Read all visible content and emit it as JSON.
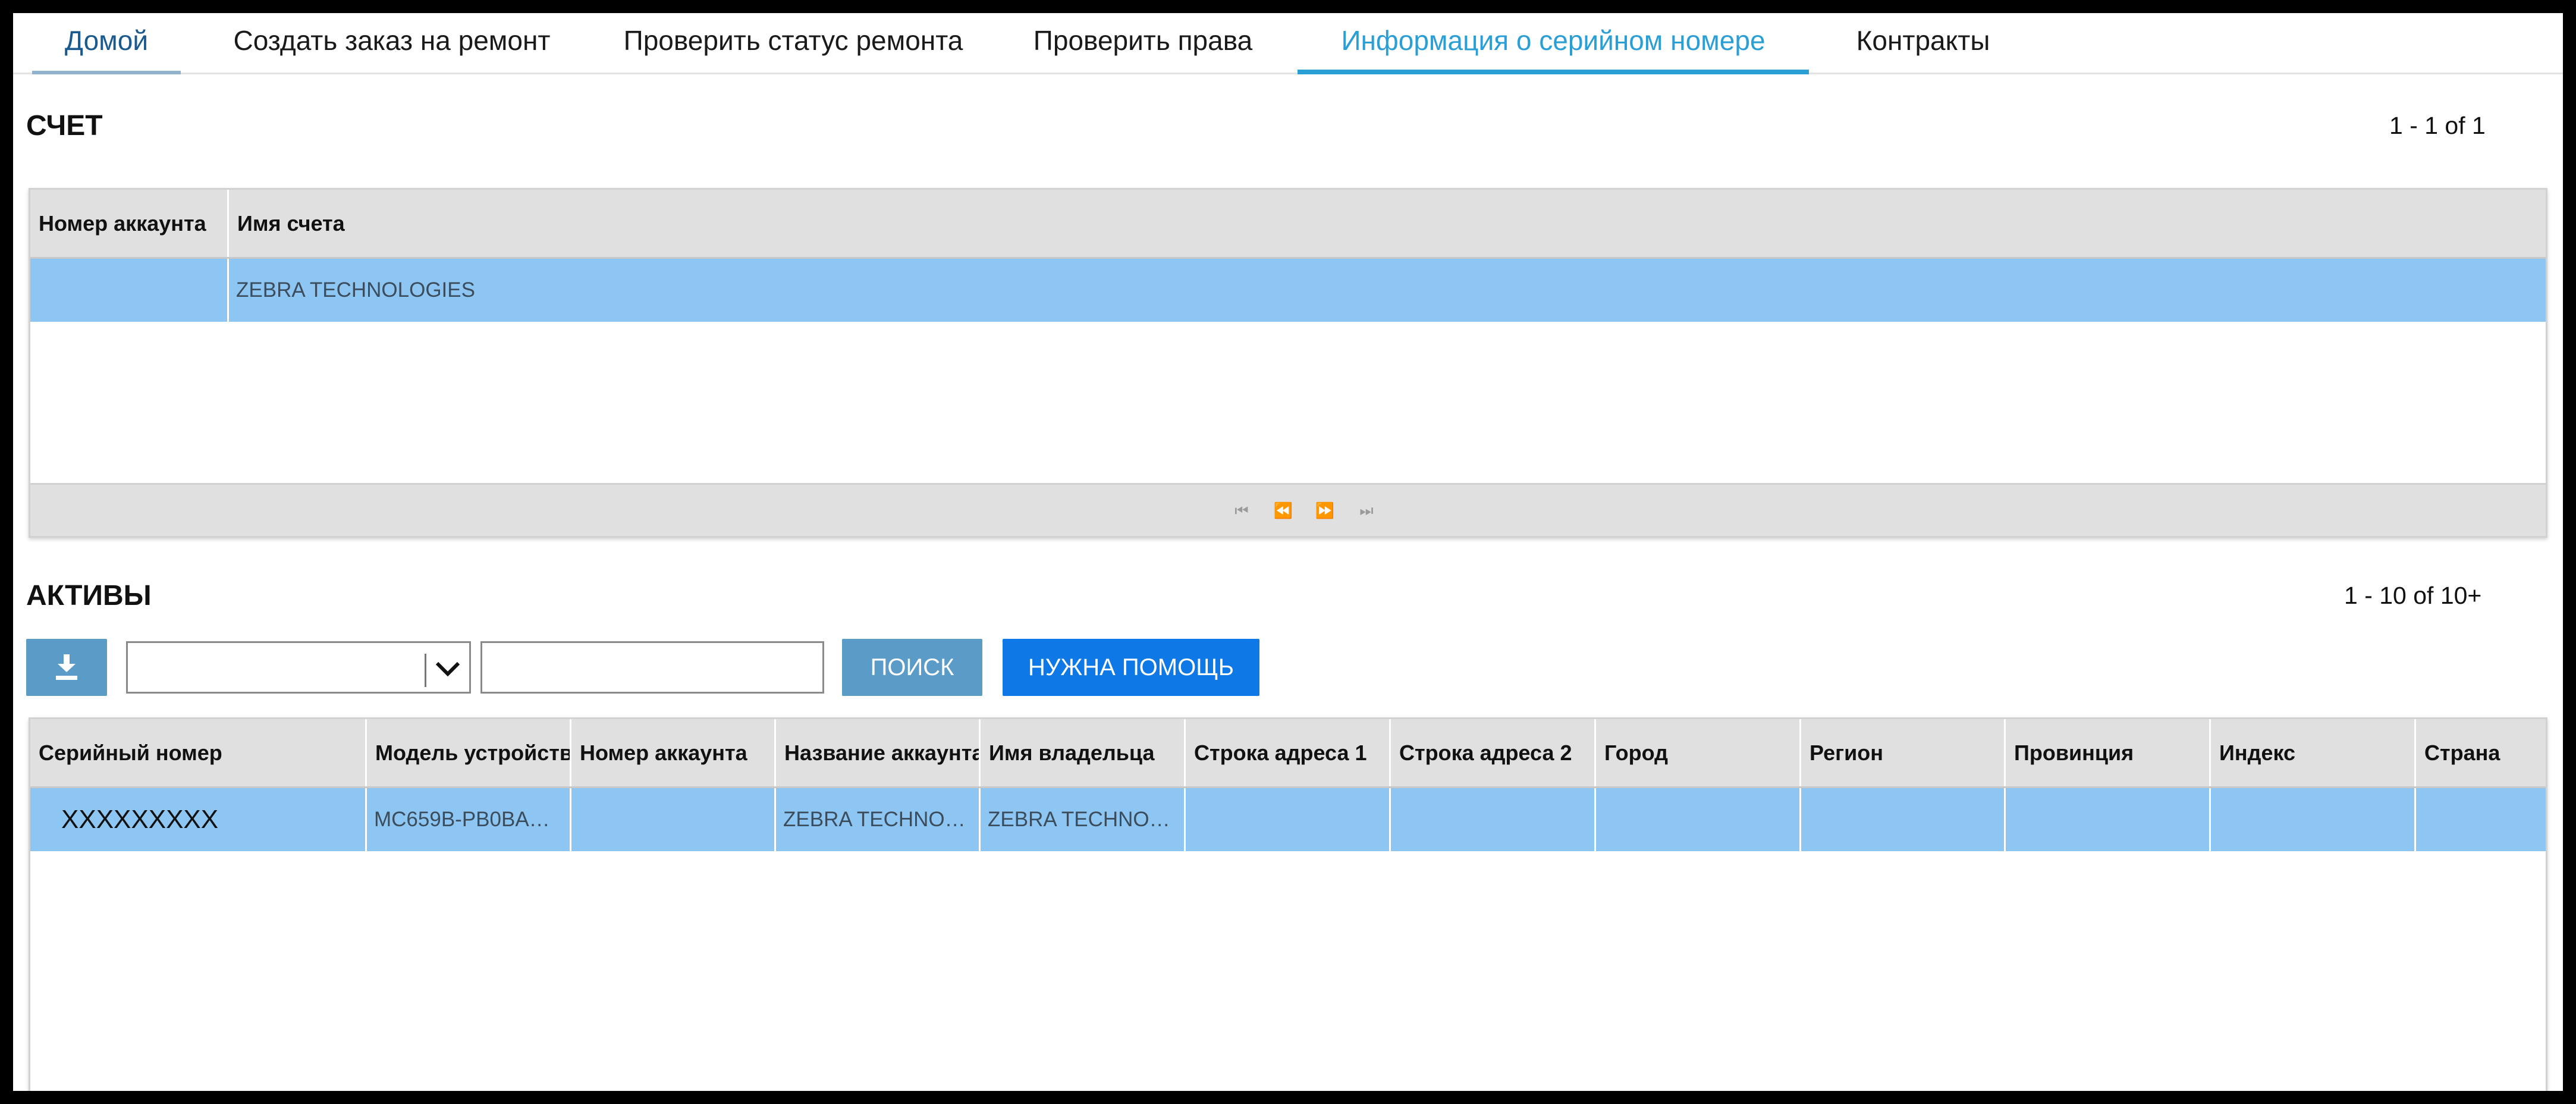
{
  "nav": {
    "tabs": [
      {
        "label": "Домой"
      },
      {
        "label": "Создать заказ на ремонт"
      },
      {
        "label": "Проверить статус ремонта"
      },
      {
        "label": "Проверить права"
      },
      {
        "label": "Информация о серийном номере"
      },
      {
        "label": "Контракты"
      }
    ],
    "active_tab": "Информация о серийном номере"
  },
  "accounts": {
    "title": "СЧЕТ",
    "count_text": "1 - 1 of 1",
    "columns": [
      "Номер аккаунта",
      "Имя счета"
    ],
    "rows": [
      {
        "account_number": "",
        "account_name": "ZEBRA TECHNOLOGIES"
      }
    ],
    "pager_icons": [
      "first-page-icon",
      "prev-page-icon",
      "next-page-icon",
      "last-page-icon"
    ]
  },
  "assets": {
    "title": "АКТИВЫ",
    "count_text": "1 - 10 of 10+",
    "toolbar": {
      "download_icon": "download-icon",
      "select_value": "",
      "search_value": "",
      "search_label": "ПОИСК",
      "help_label": "НУЖНА ПОМОЩЬ"
    },
    "columns": [
      "Серийный номер",
      "Модель устройств",
      "Номер аккаунта",
      "Название аккаунта",
      "Имя владельца",
      "Строка адреса 1",
      "Строка адреса 2",
      "Город",
      "Регион",
      "Провинция",
      "Индекс",
      "Страна"
    ],
    "rows": [
      {
        "serial": "XXXXXXXXX",
        "model": "MC659B-PB0BA…",
        "account_number": "",
        "account_name": "ZEBRA TECHNO…",
        "owner": "ZEBRA TECHNO…",
        "address1": "",
        "address2": "",
        "city": "",
        "region": "",
        "province": "",
        "zip": "",
        "country": ""
      }
    ]
  },
  "colors": {
    "active_tab": "#2a9fd6",
    "selected_row": "#8ec6f3",
    "help_button": "#0d78e6",
    "search_button": "#5a9bc7"
  }
}
